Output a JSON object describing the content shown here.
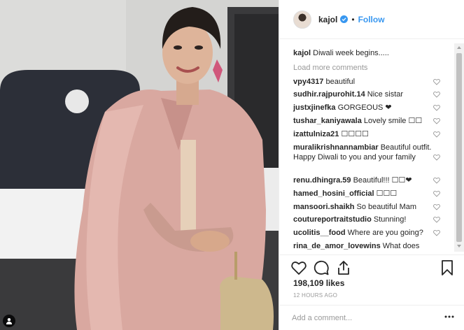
{
  "post": {
    "author": "kajol",
    "follow_label": "Follow",
    "separator": "•"
  },
  "caption": {
    "user": "kajol",
    "text": "Diwali week begins....."
  },
  "load_more_label": "Load more comments",
  "comments": [
    {
      "user": "vpy4317",
      "text": "beautiful"
    },
    {
      "user": "sudhir.rajpurohit.14",
      "text": "Nice sistar"
    },
    {
      "user": "justxjinefka",
      "text": "GORGEOUS ❤"
    },
    {
      "user": "tushar_kaniyawala",
      "text": "Lovely smile ☐☐"
    },
    {
      "user": "izattulniza21",
      "text": "☐☐☐☐"
    },
    {
      "user": "muralikrishnannambiar",
      "text": "Beautiful outfit. Happy Diwali to you and your family"
    },
    {
      "user": "renu.dhingra.59",
      "text": "Beautiful!!! ☐☐❤"
    },
    {
      "user": "hamed_hosini_official",
      "text": "☐☐☐"
    },
    {
      "user": "mansoori.shaikh",
      "text": "So beautiful Mam"
    },
    {
      "user": "coutureportraitstudio",
      "text": "Stunning!"
    },
    {
      "user": "ucolitis__food",
      "text": "Where are you going?"
    },
    {
      "user": "rina_de_amor_lovewins",
      "text": "What does"
    }
  ],
  "likes": "198,109 likes",
  "timestamp": "12 HOURS AGO",
  "add_comment": {
    "placeholder": "Add a comment...",
    "value": ""
  },
  "icons": {
    "like": "heart-outline-icon",
    "comment": "comment-icon",
    "share": "share-icon",
    "save": "bookmark-icon",
    "more": "more-horizontal-icon",
    "verified": "verified-badge-icon",
    "user_tag": "person-tag-icon"
  },
  "colors": {
    "link": "#3897f0",
    "muted": "#999999",
    "text": "#262626",
    "border": "#efefef"
  }
}
